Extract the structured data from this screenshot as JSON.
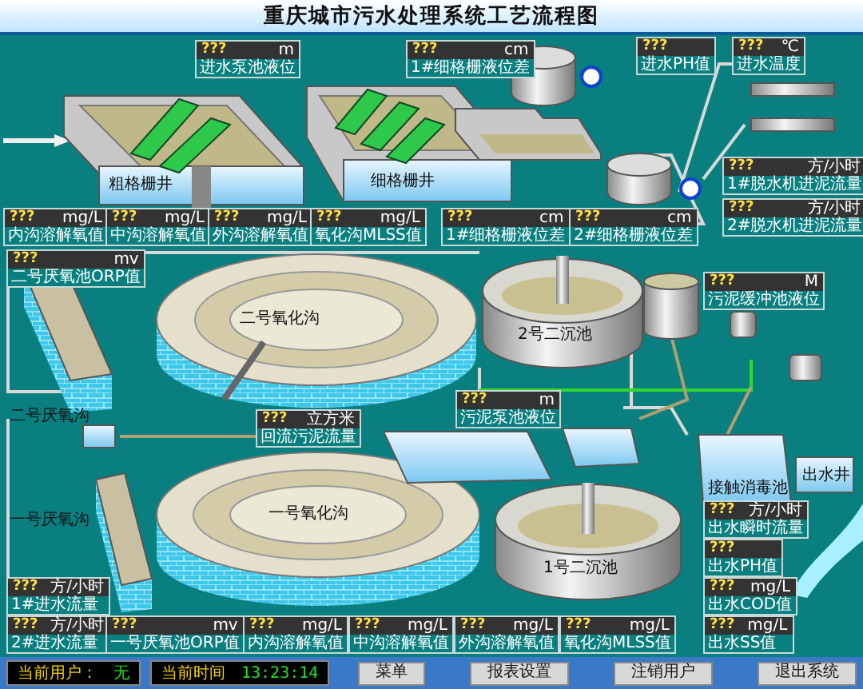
{
  "title": "重庆城市污水处理系统工艺流程图",
  "readouts": [
    {
      "value": "???",
      "unit": "m",
      "label": "进水泵池液位"
    },
    {
      "value": "???",
      "unit": "cm",
      "label": "1#细格栅液位差"
    },
    {
      "value": "???",
      "label": "进水PH值"
    },
    {
      "value": "???",
      "unit": "℃",
      "label": "进水温度"
    },
    {
      "value": "???",
      "unit": "方/小时",
      "label": "1#脱水机进泥流量"
    },
    {
      "value": "???",
      "unit": "mg/L",
      "label": "内沟溶解氧值"
    },
    {
      "value": "???",
      "unit": "mg/L",
      "label": "中沟溶解氧值"
    },
    {
      "value": "???",
      "unit": "mg/L",
      "label": "外沟溶解氧值"
    },
    {
      "value": "???",
      "unit": "mg/L",
      "label": "氧化沟MLSS值"
    },
    {
      "value": "???",
      "unit": "cm",
      "label": "1#细格栅液位差"
    },
    {
      "value": "???",
      "unit": "cm",
      "label": "2#细格栅液位差"
    },
    {
      "value": "???",
      "unit": "方/小时",
      "label": "2#脱水机进泥流量"
    },
    {
      "value": "???",
      "unit": "mv",
      "label": "二号厌氧池ORP值"
    },
    {
      "value": "???",
      "unit": "M",
      "label": "污泥缓冲池液位"
    },
    {
      "value": "???",
      "unit": "m",
      "label": "污泥泵池液位"
    },
    {
      "value": "???",
      "unit": "立方米",
      "label": "回流污泥流量"
    },
    {
      "value": "???",
      "unit": "方/小时",
      "label": "出水瞬时流量"
    },
    {
      "value": "???",
      "label": "出水PH值"
    },
    {
      "value": "???",
      "unit": "方/小时",
      "label": "1#进水流量"
    },
    {
      "value": "???",
      "unit": "mg/L",
      "label": "出水COD值"
    },
    {
      "value": "???",
      "unit": "方/小时",
      "label": "2#进水流量"
    },
    {
      "value": "???",
      "unit": "mv",
      "label": "一号厌氧池ORP值"
    },
    {
      "value": "???",
      "unit": "mg/L",
      "label": "内沟溶解氧值"
    },
    {
      "value": "???",
      "unit": "mg/L",
      "label": "中沟溶解氧值"
    },
    {
      "value": "???",
      "unit": "mg/L",
      "label": "外沟溶解氧值"
    },
    {
      "value": "???",
      "unit": "mg/L",
      "label": "氧化沟MLSS值"
    },
    {
      "value": "???",
      "unit": "mg/L",
      "label": "出水SS值"
    }
  ],
  "plant_labels": [
    "粗格栅井",
    "细格栅井",
    "二号氧化沟",
    "二号厌氧沟",
    "2号二沉池",
    "一号厌氧沟",
    "一号氧化沟",
    "1号二沉池",
    "接触消毒池",
    "出水井"
  ],
  "status": {
    "user_label": "当前用户：",
    "user": "无",
    "time_label": "当前时间",
    "time": "13:23:14"
  },
  "buttons": [
    "菜单",
    "报表设置",
    "注销用户",
    "退出系统"
  ]
}
